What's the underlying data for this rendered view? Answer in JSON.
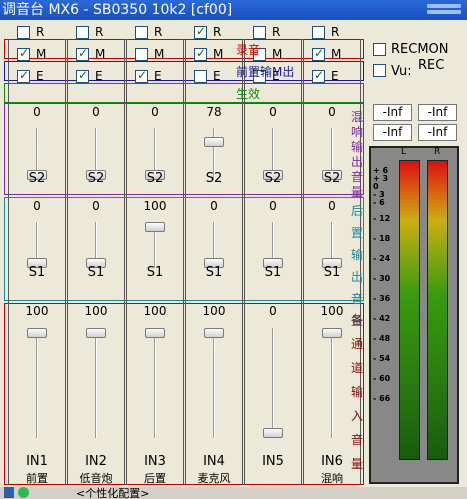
{
  "title": "调音台 MX6 - SB0350 10k2 [cf00]",
  "row_labels": {
    "rec": "录音",
    "mon": "前置输M出",
    "eff": "生效"
  },
  "letters": {
    "r": "R",
    "m": "M",
    "e": "E"
  },
  "channels": [
    {
      "name": "IN1",
      "alias": "前置",
      "r": false,
      "m": true,
      "e": true,
      "s2": "0",
      "s1": "0",
      "main": "100",
      "s2_level": 0,
      "s1_level": 0,
      "main_level": 100
    },
    {
      "name": "IN2",
      "alias": "低音炮",
      "r": false,
      "m": true,
      "e": true,
      "s2": "0",
      "s1": "0",
      "main": "100",
      "s2_level": 0,
      "s1_level": 0,
      "main_level": 100
    },
    {
      "name": "IN3",
      "alias": "后置",
      "r": false,
      "m": false,
      "e": true,
      "s2": "0",
      "s1": "100",
      "main": "100",
      "s2_level": 0,
      "s1_level": 100,
      "main_level": 100
    },
    {
      "name": "IN4",
      "alias": "麦克风",
      "r": true,
      "m": true,
      "e": false,
      "s2": "78",
      "s1": "0",
      "main": "100",
      "s2_level": 78,
      "s1_level": 0,
      "main_level": 100
    },
    {
      "name": "IN5",
      "alias": "",
      "r": false,
      "m": false,
      "e": false,
      "s2": "0",
      "s1": "0",
      "main": "0",
      "s2_level": 0,
      "s1_level": 0,
      "main_level": 0
    },
    {
      "name": "IN6",
      "alias": "混响",
      "r": false,
      "m": true,
      "e": true,
      "s2": "0",
      "s1": "0",
      "main": "100",
      "s2_level": 0,
      "s1_level": 0,
      "main_level": 100
    }
  ],
  "send_labels": {
    "s2": "S2",
    "s1": "S1"
  },
  "side_labels": {
    "s2": "混响输出音量",
    "s1": "后置输出音量",
    "main": "各通道输入音量"
  },
  "recmon": {
    "label": "RECMON",
    "checked": false
  },
  "vu": {
    "label": "Vu:",
    "checked": false,
    "value": "REC"
  },
  "peak_buttons": [
    "-Inf",
    "-Inf",
    "-Inf",
    "-Inf"
  ],
  "meter": {
    "left_label": "L",
    "right_label": "R",
    "scale": [
      "+ 6",
      "+ 3",
      "0",
      "- 3",
      "- 6",
      "- 12",
      "- 18",
      "- 24",
      "- 30",
      "- 36",
      "- 42",
      "- 48",
      "- 54",
      "- 60",
      "- 66"
    ]
  },
  "status_text": "<个性化配置>"
}
